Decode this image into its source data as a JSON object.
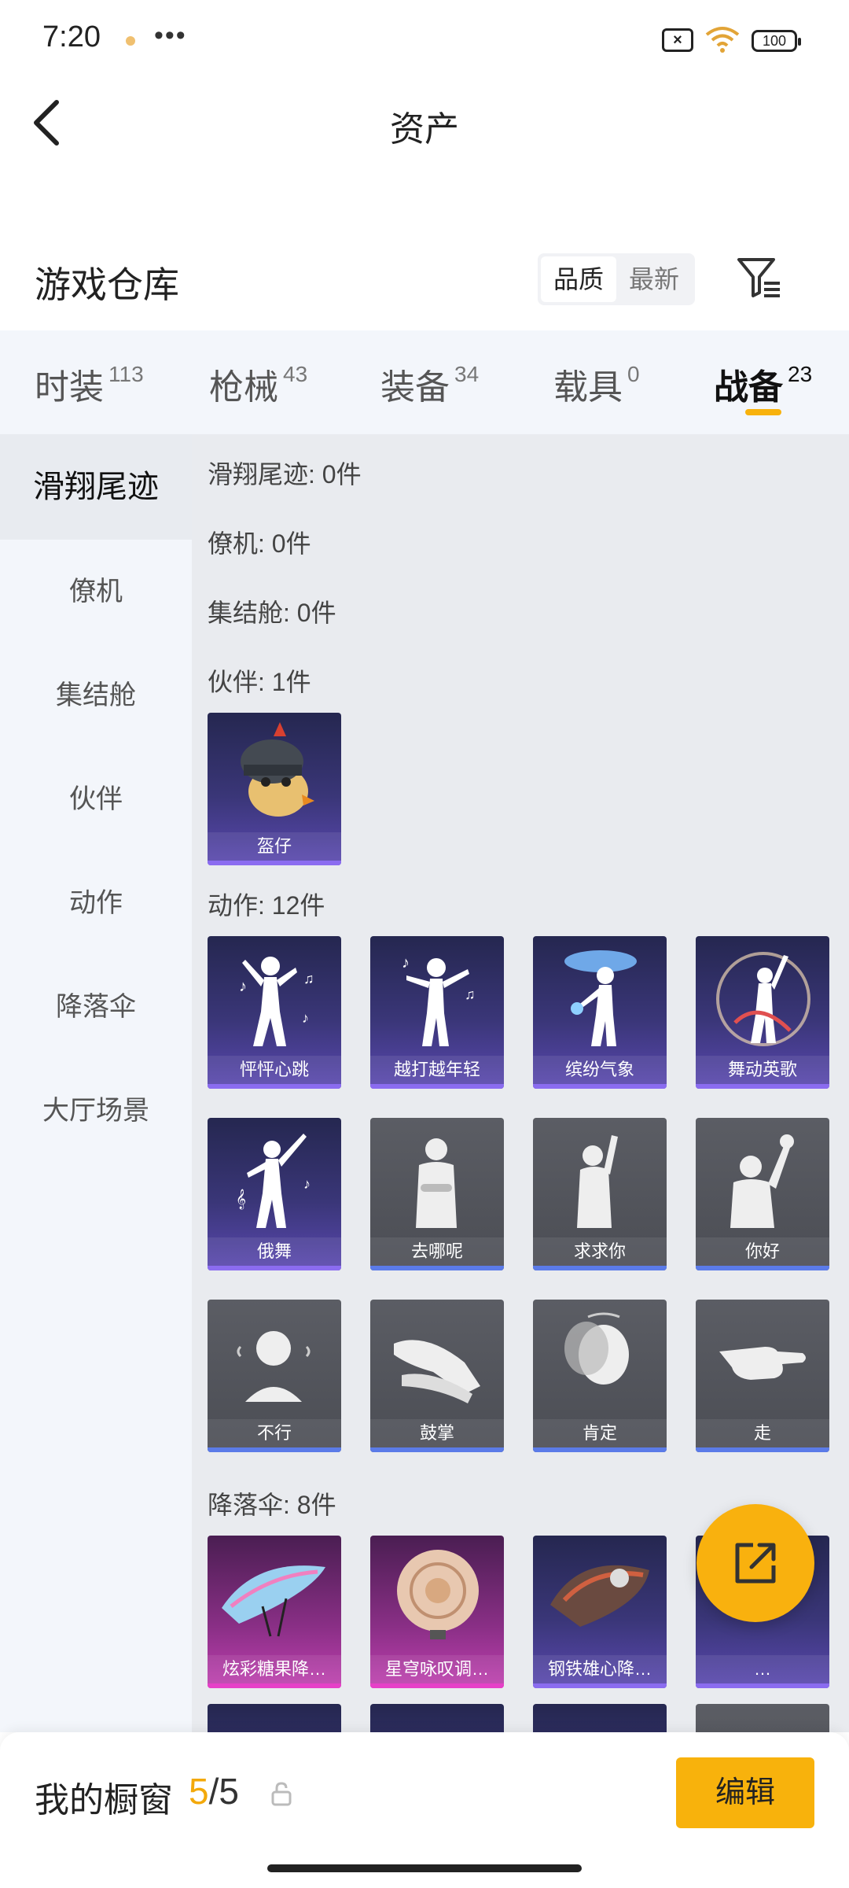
{
  "status_bar": {
    "time": "7:20",
    "more": "•••",
    "sim": "×",
    "battery": "100"
  },
  "header": {
    "title": "资产"
  },
  "warehouse": {
    "title": "游戏仓库",
    "sort_options": [
      "品质",
      "最新"
    ],
    "active_sort": "品质"
  },
  "tabs": [
    {
      "label": "时装",
      "count": "113"
    },
    {
      "label": "枪械",
      "count": "43"
    },
    {
      "label": "装备",
      "count": "34"
    },
    {
      "label": "载具",
      "count": "0"
    },
    {
      "label": "战备",
      "count": "23"
    }
  ],
  "active_tab": "战备",
  "side_menu": [
    "滑翔尾迹",
    "僚机",
    "集结舱",
    "伙伴",
    "动作",
    "降落伞",
    "大厅场景"
  ],
  "active_side": "滑翔尾迹",
  "sections": {
    "glide_trail": "滑翔尾迹: 0件",
    "wingman": "僚机: 0件",
    "rally_pod": "集结舱: 0件",
    "partner": "伙伴: 1件",
    "emote": "动作: 12件",
    "parachute": "降落伞: 8件"
  },
  "partner_items": [
    "盔仔"
  ],
  "emote_items": [
    "怦怦心跳",
    "越打越年轻",
    "缤纷气象",
    "舞动英歌",
    "俄舞",
    "去哪呢",
    "求求你",
    "你好",
    "不行",
    "鼓掌",
    "肯定",
    "走"
  ],
  "parachute_items": [
    "炫彩糖果降…",
    "星穹咏叹调…",
    "钢铁雄心降…",
    "…"
  ],
  "bottom": {
    "label": "我的橱窗",
    "current": "5",
    "total": "/5",
    "edit": "编辑"
  },
  "colors": {
    "accent": "#f8b20c",
    "purple_card": "#3a3678",
    "gray_card": "#4b4d54",
    "pink_card": "#8a2f86"
  }
}
